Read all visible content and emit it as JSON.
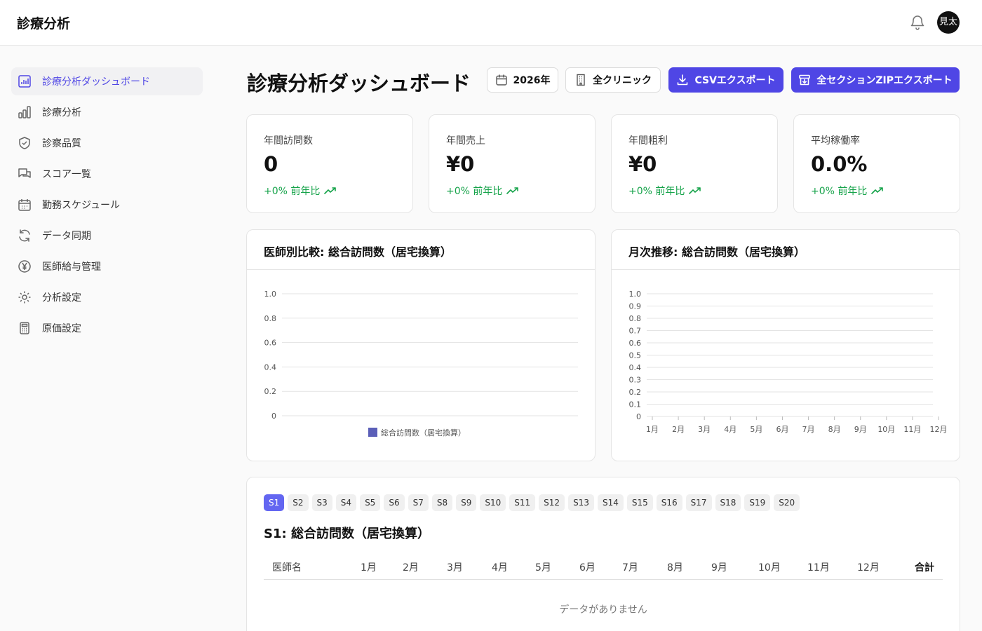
{
  "app_title": "診療分析",
  "user": {
    "avatar_initials": "見太"
  },
  "sidebar": {
    "items": [
      {
        "label": "診療分析ダッシュボード",
        "icon": "bar-chart-icon",
        "active": true
      },
      {
        "label": "診療分析",
        "icon": "column-chart-icon"
      },
      {
        "label": "診察品質",
        "icon": "shield-check-icon"
      },
      {
        "label": "スコア一覧",
        "icon": "chat-bubbles-icon"
      },
      {
        "label": "勤務スケジュール",
        "icon": "calendar-icon"
      },
      {
        "label": "データ同期",
        "icon": "refresh-icon"
      },
      {
        "label": "医師給与管理",
        "icon": "yen-circle-icon"
      },
      {
        "label": "分析設定",
        "icon": "gear-icon"
      },
      {
        "label": "原価設定",
        "icon": "calculator-icon"
      }
    ]
  },
  "header": {
    "title": "診療分析ダッシュボード",
    "year_button": "2026年",
    "clinic_button": "全クリニック",
    "csv_button": "CSVエクスポート",
    "zip_button": "全セクションZIPエクスポート"
  },
  "stats": [
    {
      "label": "年間訪問数",
      "value": "0",
      "change": "+0% 前年比"
    },
    {
      "label": "年間売上",
      "value": "¥0",
      "change": "+0% 前年比"
    },
    {
      "label": "年間粗利",
      "value": "¥0",
      "change": "+0% 前年比"
    },
    {
      "label": "平均稼働率",
      "value": "0.0%",
      "change": "+0% 前年比"
    }
  ],
  "colors": {
    "accent": "#4f46e5",
    "chip_active": "#6366f1",
    "positive": "#16a34a",
    "legend_swatch": "#5b5fb8"
  },
  "chart_data": [
    {
      "type": "bar",
      "title": "医師別比較: 総合訪問数（居宅換算）",
      "categories": [],
      "series": [
        {
          "name": "総合訪問数（居宅換算）",
          "values": []
        }
      ],
      "ylim": [
        0,
        1.0
      ],
      "yticks": [
        "1.0",
        "0.8",
        "0.6",
        "0.4",
        "0.2",
        "0"
      ],
      "grid": true,
      "legend": "bottom"
    },
    {
      "type": "line",
      "title": "月次推移: 総合訪問数（居宅換算）",
      "categories": [
        "1月",
        "2月",
        "3月",
        "4月",
        "5月",
        "6月",
        "7月",
        "8月",
        "9月",
        "10月",
        "11月",
        "12月"
      ],
      "series": [],
      "ylim": [
        0,
        1.0
      ],
      "yticks": [
        "1.0",
        "0.9",
        "0.8",
        "0.7",
        "0.6",
        "0.5",
        "0.4",
        "0.3",
        "0.2",
        "0.1",
        "0"
      ],
      "grid": true
    }
  ],
  "sections": {
    "chips": [
      "S1",
      "S2",
      "S3",
      "S4",
      "S5",
      "S6",
      "S7",
      "S8",
      "S9",
      "S10",
      "S11",
      "S12",
      "S13",
      "S14",
      "S15",
      "S16",
      "S17",
      "S18",
      "S19",
      "S20"
    ],
    "active_chip": "S1",
    "title": "S1: 総合訪問数（居宅換算）",
    "table_headers": [
      "医師名",
      "1月",
      "2月",
      "3月",
      "4月",
      "5月",
      "6月",
      "7月",
      "8月",
      "9月",
      "10月",
      "11月",
      "12月",
      "合計"
    ],
    "empty_message": "データがありません"
  }
}
